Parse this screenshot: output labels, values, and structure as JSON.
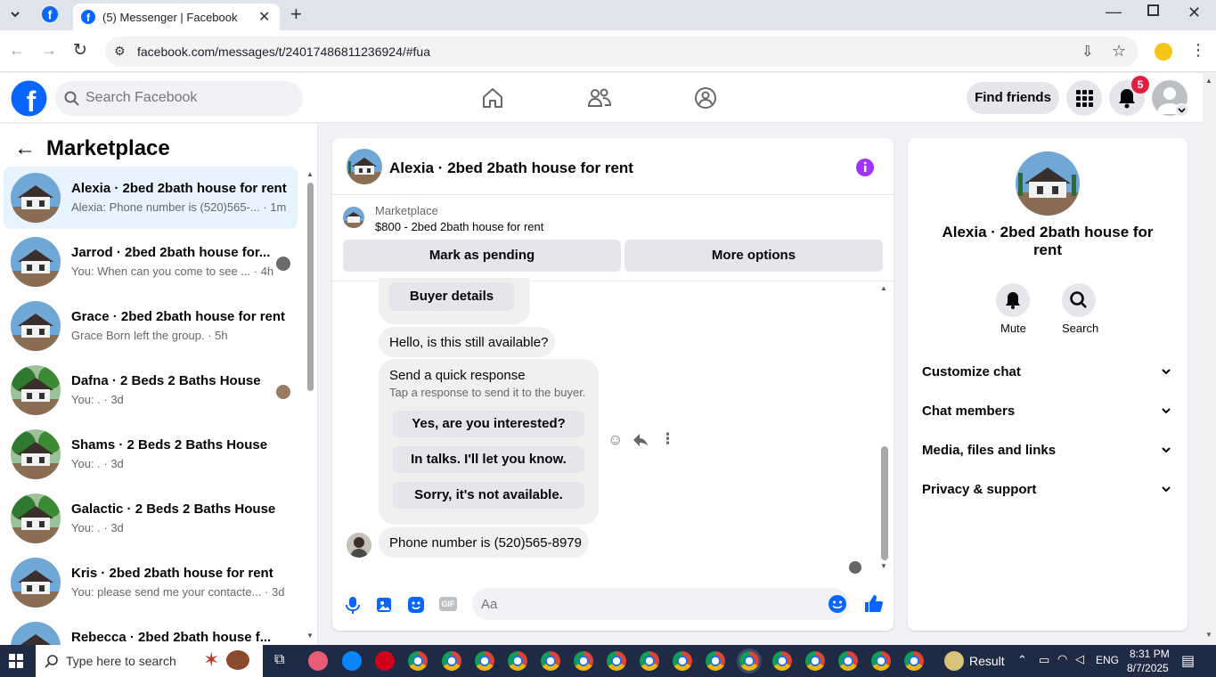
{
  "browser": {
    "tab_title": "(5) Messenger | Facebook",
    "url": "facebook.com/messages/t/24017486811236924/#fua"
  },
  "header": {
    "search_placeholder": "Search Facebook",
    "find_friends": "Find friends",
    "notification_count": "5"
  },
  "sidebar": {
    "title": "Marketplace",
    "conversations": [
      {
        "title": "Alexia · 2bed 2bath house for rent",
        "preview": "Alexia: Phone number is (520)565-... · 1m"
      },
      {
        "title": "Jarrod · 2bed 2bath house for...",
        "preview": "You: When can you come to see ... · 4h"
      },
      {
        "title": "Grace · 2bed 2bath house for rent",
        "preview": "Grace Born left the group. · 5h"
      },
      {
        "title": "Dafna · 2 Beds 2 Baths House",
        "preview": "You: . · 3d"
      },
      {
        "title": "Shams · 2 Beds 2 Baths House",
        "preview": "You: . · 3d"
      },
      {
        "title": "Galactic · 2 Beds 2 Baths House",
        "preview": "You: . · 3d"
      },
      {
        "title": "Kris · 2bed 2bath house for rent",
        "preview": "You: please send me your contacte... · 3d"
      },
      {
        "title": "Rebecca · 2bed 2bath house f...",
        "preview": ""
      }
    ]
  },
  "chat": {
    "title": "Alexia · 2bed 2bath house for rent",
    "listing_label": "Marketplace",
    "listing_text": "$800 - 2bed 2bath house for rent",
    "mark_pending": "Mark as pending",
    "more_options": "More options",
    "buyer_details": "Buyer details",
    "msg_available": "Hello, is this still available?",
    "quick_title": "Send a quick response",
    "quick_sub": "Tap a response to send it to the buyer.",
    "quick_options": [
      "Yes, are you interested?",
      "In talks. I'll let you know.",
      "Sorry, it's not available."
    ],
    "msg_phone": "Phone number is (520)565-8979",
    "composer_placeholder": "Aa"
  },
  "details": {
    "name": "Alexia · 2bed 2bath house for rent",
    "mute": "Mute",
    "search": "Search",
    "sections": [
      "Customize chat",
      "Chat members",
      "Media, files and links",
      "Privacy & support"
    ]
  },
  "taskbar": {
    "search_placeholder": "Type here to search",
    "result_label": "Result",
    "lang": "ENG",
    "time": "8:31 PM",
    "date": "8/7/2025"
  },
  "colors": {
    "fb_blue": "#0866ff",
    "purple": "#a033ff",
    "notif_red": "#e41e3f"
  }
}
